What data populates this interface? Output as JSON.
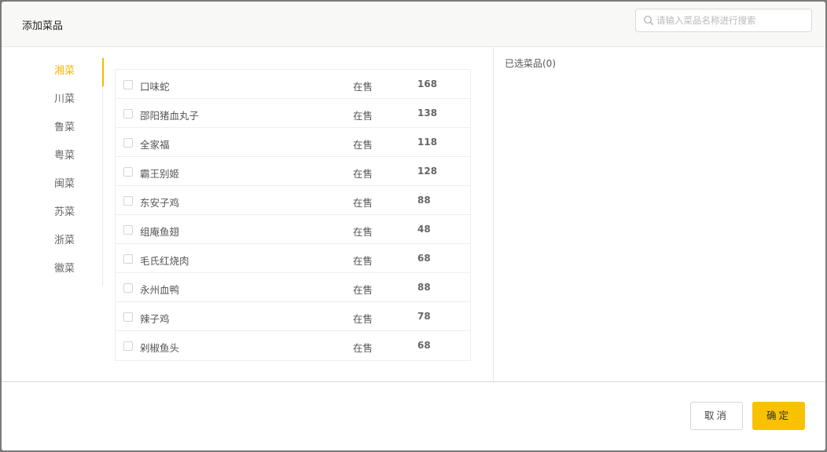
{
  "dialog": {
    "title": "添加菜品",
    "search": {
      "placeholder": "请输入菜品名称进行搜索",
      "value": ""
    }
  },
  "categories": [
    {
      "label": "湘菜",
      "active": true
    },
    {
      "label": "川菜",
      "active": false
    },
    {
      "label": "鲁菜",
      "active": false
    },
    {
      "label": "粤菜",
      "active": false
    },
    {
      "label": "闽菜",
      "active": false
    },
    {
      "label": "苏菜",
      "active": false
    },
    {
      "label": "浙菜",
      "active": false
    },
    {
      "label": "徽菜",
      "active": false
    }
  ],
  "dishes": [
    {
      "name": "口味蛇",
      "status": "在售",
      "price": "168",
      "checked": false
    },
    {
      "name": "邵阳猪血丸子",
      "status": "在售",
      "price": "138",
      "checked": false
    },
    {
      "name": "全家福",
      "status": "在售",
      "price": "118",
      "checked": false
    },
    {
      "name": "霸王别姬",
      "status": "在售",
      "price": "128",
      "checked": false
    },
    {
      "name": "东安子鸡",
      "status": "在售",
      "price": "88",
      "checked": false
    },
    {
      "name": "组庵鱼翅",
      "status": "在售",
      "price": "48",
      "checked": false
    },
    {
      "name": "毛氏红烧肉",
      "status": "在售",
      "price": "68",
      "checked": false
    },
    {
      "name": "永州血鸭",
      "status": "在售",
      "price": "88",
      "checked": false
    },
    {
      "name": "辣子鸡",
      "status": "在售",
      "price": "78",
      "checked": false
    },
    {
      "name": "剁椒鱼头",
      "status": "在售",
      "price": "68",
      "checked": false
    }
  ],
  "selected": {
    "label": "已选菜品(0)"
  },
  "footer": {
    "cancel_label": "取消",
    "ok_label": "确定"
  },
  "colors": {
    "accent": "#f5b800",
    "primary_button": "#f8c200"
  },
  "icons": {
    "search": "search-icon"
  }
}
